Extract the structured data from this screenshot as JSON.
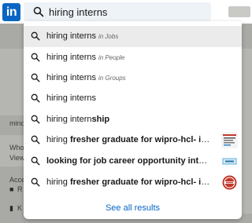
{
  "header": {
    "logo_text": "in",
    "search": {
      "value": "hiring interns",
      "placeholder": ""
    }
  },
  "background": {
    "texts": [
      "mindt",
      "Who v",
      "View",
      "Acce",
      "R",
      "K"
    ]
  },
  "suggestions": [
    {
      "query": "hiring interns",
      "bold": "",
      "scope": "in Jobs",
      "thumb": null
    },
    {
      "query": "hiring interns",
      "bold": "",
      "scope": "in People",
      "thumb": null
    },
    {
      "query": "hiring interns",
      "bold": "",
      "scope": "in Groups",
      "thumb": null
    },
    {
      "query": "hiring interns",
      "bold": "",
      "scope": "",
      "thumb": null
    },
    {
      "query": "hiring intern",
      "bold": "ship",
      "scope": "",
      "thumb": null
    },
    {
      "query": "hiring ",
      "bold": "fresher graduate for wipro-hcl- ibm b...",
      "scope": "",
      "thumb": "flyer"
    },
    {
      "query": "",
      "bold": "looking for job career opportunity internshi...",
      "scope": "",
      "thumb": "badge-blue"
    },
    {
      "query": "hiring ",
      "bold": "fresher graduate for wipro-hcl- ibm b...",
      "scope": "",
      "thumb": "seal-red"
    }
  ],
  "see_all_label": "See all results",
  "colors": {
    "brand": "#0a66c2",
    "overlay": "#a9a9a6",
    "active_row": "#ebebeb"
  }
}
